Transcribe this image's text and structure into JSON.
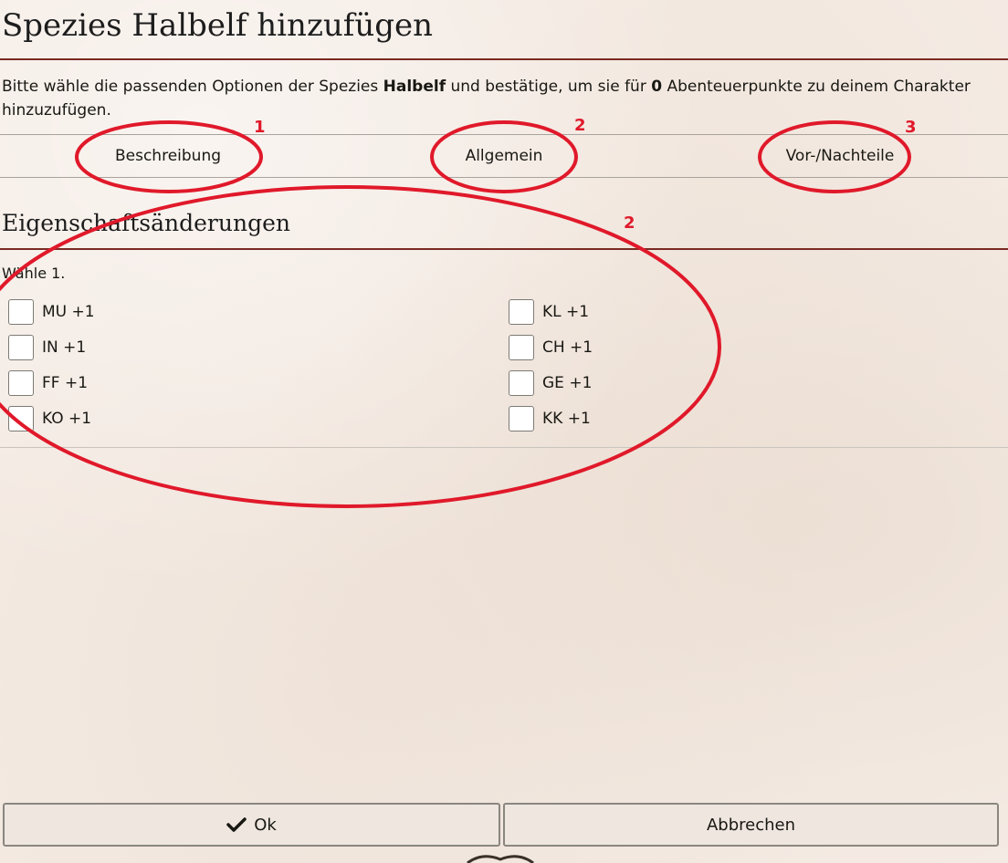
{
  "dialog": {
    "title": "Spezies Halbelf hinzufügen",
    "intro_part1": "Bitte wähle die passenden Optionen der Spezies ",
    "species": "Halbelf",
    "intro_part2": " und bestätige, um sie für ",
    "ap": "0",
    "intro_part3": " Abenteuerpunkte zu deinem Charakter hinzuzufügen."
  },
  "tabs": [
    {
      "label": "Beschreibung"
    },
    {
      "label": "Allgemein"
    },
    {
      "label": "Vor-/Nachteile"
    }
  ],
  "section": {
    "title": "Eigenschaftsänderungen",
    "choose_label": "Wähle 1."
  },
  "options_left": [
    {
      "label": "MU +1",
      "checked": false
    },
    {
      "label": "IN +1",
      "checked": false
    },
    {
      "label": "FF +1",
      "checked": false
    },
    {
      "label": "KO +1",
      "checked": false
    }
  ],
  "options_right": [
    {
      "label": "KL +1",
      "checked": false
    },
    {
      "label": "CH +1",
      "checked": false
    },
    {
      "label": "GE +1",
      "checked": false
    },
    {
      "label": "KK +1",
      "checked": false
    }
  ],
  "buttons": {
    "ok": "Ok",
    "cancel": "Abbrechen"
  },
  "annotations": {
    "color": "#e0192a",
    "numbers": [
      "1",
      "2",
      "3",
      "2"
    ]
  },
  "colors": {
    "accent": "#7a2a22",
    "background": "#f4ebe4"
  }
}
